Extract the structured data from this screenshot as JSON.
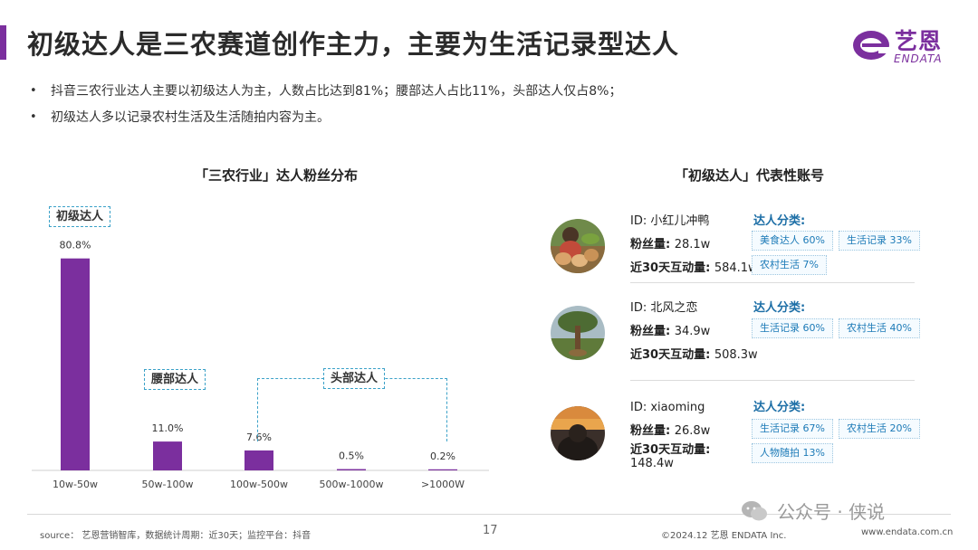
{
  "header": {
    "title": "初级达人是三农赛道创作主力，主要为生活记录型达人",
    "logo_cn": "艺恩",
    "logo_en": "ENDATA",
    "accent_color": "#7b2f9e"
  },
  "bullets": [
    "抖音三农行业达人主要以初级达人为主，人数占比达到81%；腰部达人占比11%，头部达人仅占8%；",
    "初级达人多以记录农村生活及生活随拍内容为主。"
  ],
  "chart_section": {
    "title": "「三农行业」达人粉丝分布",
    "group_labels": {
      "junior": "初级达人",
      "middle": "腰部达人",
      "head": "头部达人"
    }
  },
  "chart_data": {
    "type": "bar",
    "title": "「三农行业」达人粉丝分布",
    "categories": [
      "10w-50w",
      "50w-100w",
      "100w-500w",
      "500w-1000w",
      ">1000W"
    ],
    "values": [
      80.8,
      11.0,
      7.6,
      0.5,
      0.2
    ],
    "value_labels": [
      "80.8%",
      "11.0%",
      "7.6%",
      "0.5%",
      "0.2%"
    ],
    "unit": "%",
    "ylim": [
      0,
      100
    ],
    "grid": false,
    "bar_color": "#7b2f9e"
  },
  "accounts_section": {
    "title": "「初级达人」代表性账号",
    "id_label": "ID: ",
    "fans_label": "粉丝量: ",
    "interact_label": "近30天互动量: ",
    "category_label": "达人分类:",
    "accounts": [
      {
        "id": "小红儿冲鸭",
        "fans": "28.1w",
        "interactions": "584.1w",
        "avatar": "dogs-avatar",
        "tags": [
          "美食达人 60%",
          "生活记录 33%",
          "农村生活 7%"
        ]
      },
      {
        "id": "北风之恋",
        "fans": "34.9w",
        "interactions": "508.3w",
        "avatar": "tree-avatar",
        "tags": [
          "生活记录 60%",
          "农村生活 40%"
        ]
      },
      {
        "id": "xiaoming",
        "fans": "26.8w",
        "interactions": "148.4w",
        "avatar": "sunset-avatar",
        "tags": [
          "生活记录 67%",
          "农村生活 20%",
          "人物随拍 13%"
        ]
      }
    ]
  },
  "footer": {
    "source": "source： 艺恩营销智库，数据统计周期：近30天；监控平台：抖音",
    "page": "17",
    "copyright": "©2024.12  艺恩 ENDATA Inc.",
    "url": "www.endata.com.cn"
  },
  "watermark": "公众号 · 侠说"
}
